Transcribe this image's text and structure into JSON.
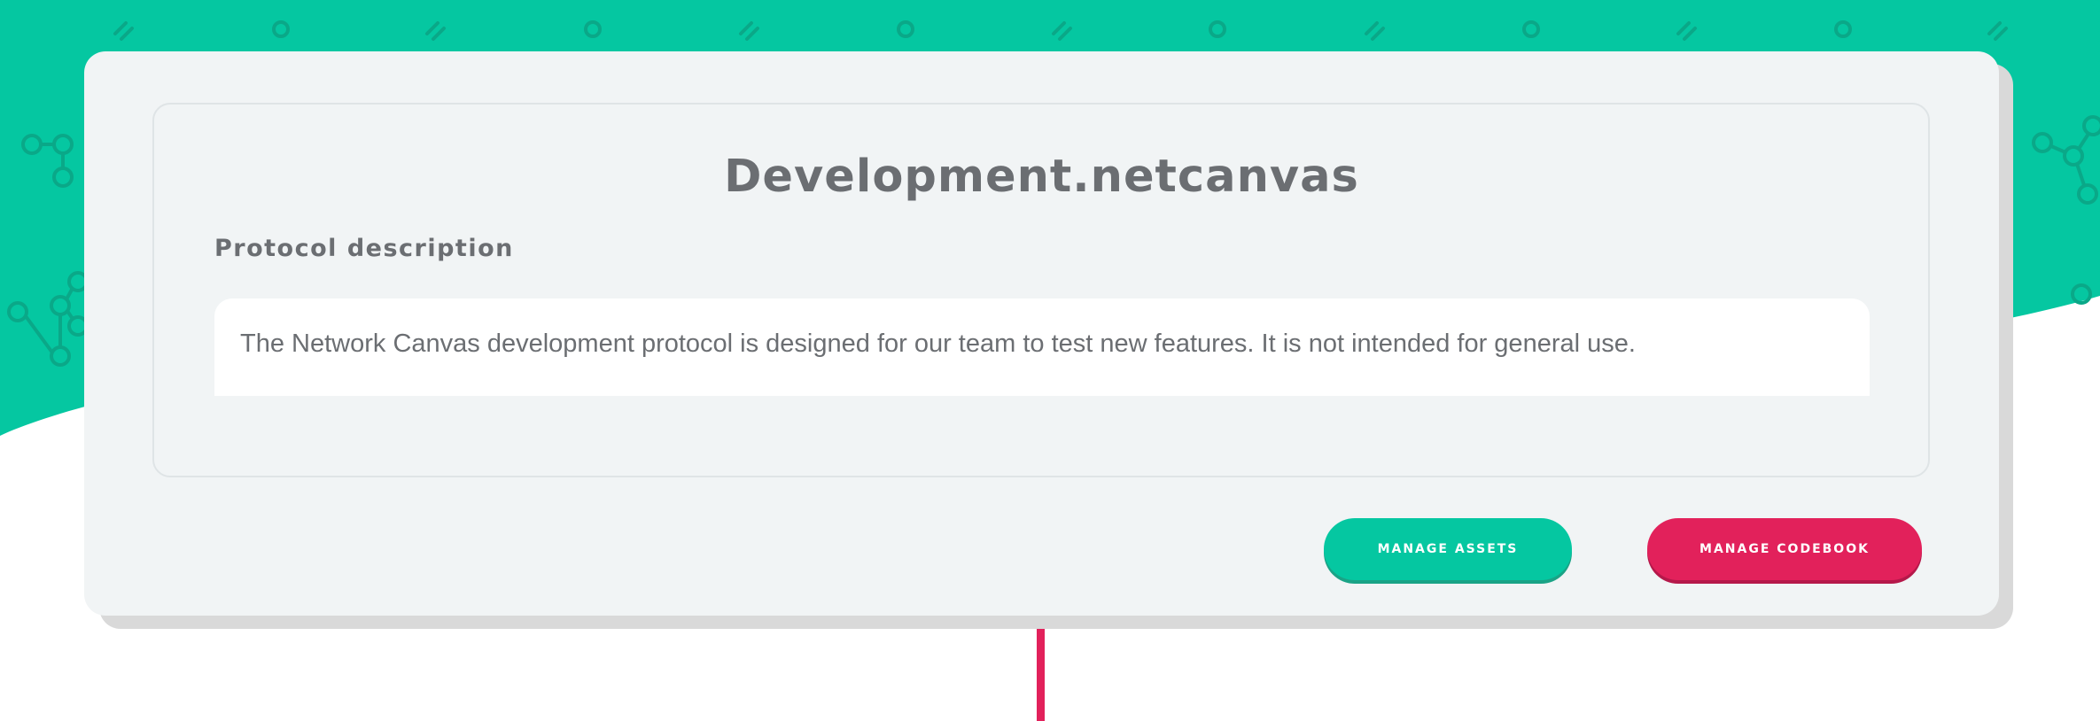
{
  "protocol": {
    "title": "Development.netcanvas",
    "description_heading": "Protocol description",
    "description": "The Network Canvas development protocol is designed for our team to test new features. It is not intended for general use."
  },
  "actions": {
    "manage_assets": "MANAGE ASSETS",
    "manage_codebook": "MANAGE CODEBOOK"
  },
  "theme": {
    "brand_green": "#05c7a1",
    "brand_green_dark": "#0aa888",
    "brand_pink": "#e2215b",
    "card_background": "#f1f4f5",
    "text_color": "#6b6e72",
    "pattern_icons": [
      "slash-icon",
      "circle-icon",
      "node-graph-icon"
    ]
  }
}
